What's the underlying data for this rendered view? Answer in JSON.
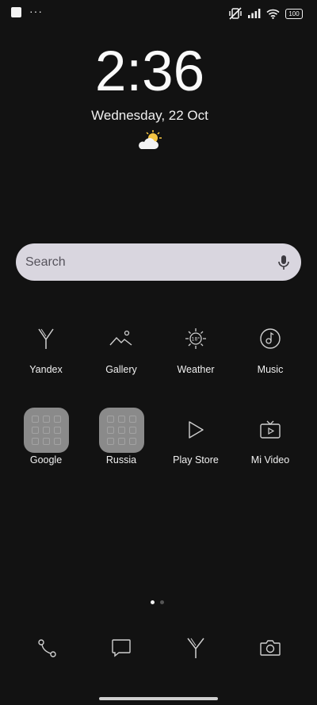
{
  "status_bar": {
    "left_icons": [
      "app-notification-icon",
      "more-notifications-icon"
    ],
    "right_icons": [
      "mute-vibrate-icon",
      "signal-icon",
      "wifi-icon",
      "battery-icon"
    ],
    "battery_level": "100"
  },
  "clock": {
    "time": "2:36",
    "date": "Wednesday, 22 Oct",
    "weather_icon": "partly-sunny-icon"
  },
  "search": {
    "placeholder": "Search",
    "mic_icon": "microphone-icon"
  },
  "apps": [
    {
      "label": "Yandex",
      "icon": "yandex-icon"
    },
    {
      "label": "Gallery",
      "icon": "gallery-icon"
    },
    {
      "label": "Weather",
      "icon": "weather-icon"
    },
    {
      "label": "Music",
      "icon": "music-icon"
    },
    {
      "label": "Google",
      "icon": "folder-icon"
    },
    {
      "label": "Russia",
      "icon": "folder-icon"
    },
    {
      "label": "Play Store",
      "icon": "play-store-icon"
    },
    {
      "label": "Mi Video",
      "icon": "mi-video-icon"
    }
  ],
  "page_indicator": {
    "pages": 2,
    "current": 1
  },
  "dock": [
    {
      "icon": "phone-icon"
    },
    {
      "icon": "messages-icon"
    },
    {
      "icon": "yandex-browser-icon"
    },
    {
      "icon": "camera-icon"
    }
  ],
  "colors": {
    "background": "#121212",
    "search_bar": "#d9d6df",
    "folder": "#8a8a8a",
    "text": "#f2f2f2"
  }
}
